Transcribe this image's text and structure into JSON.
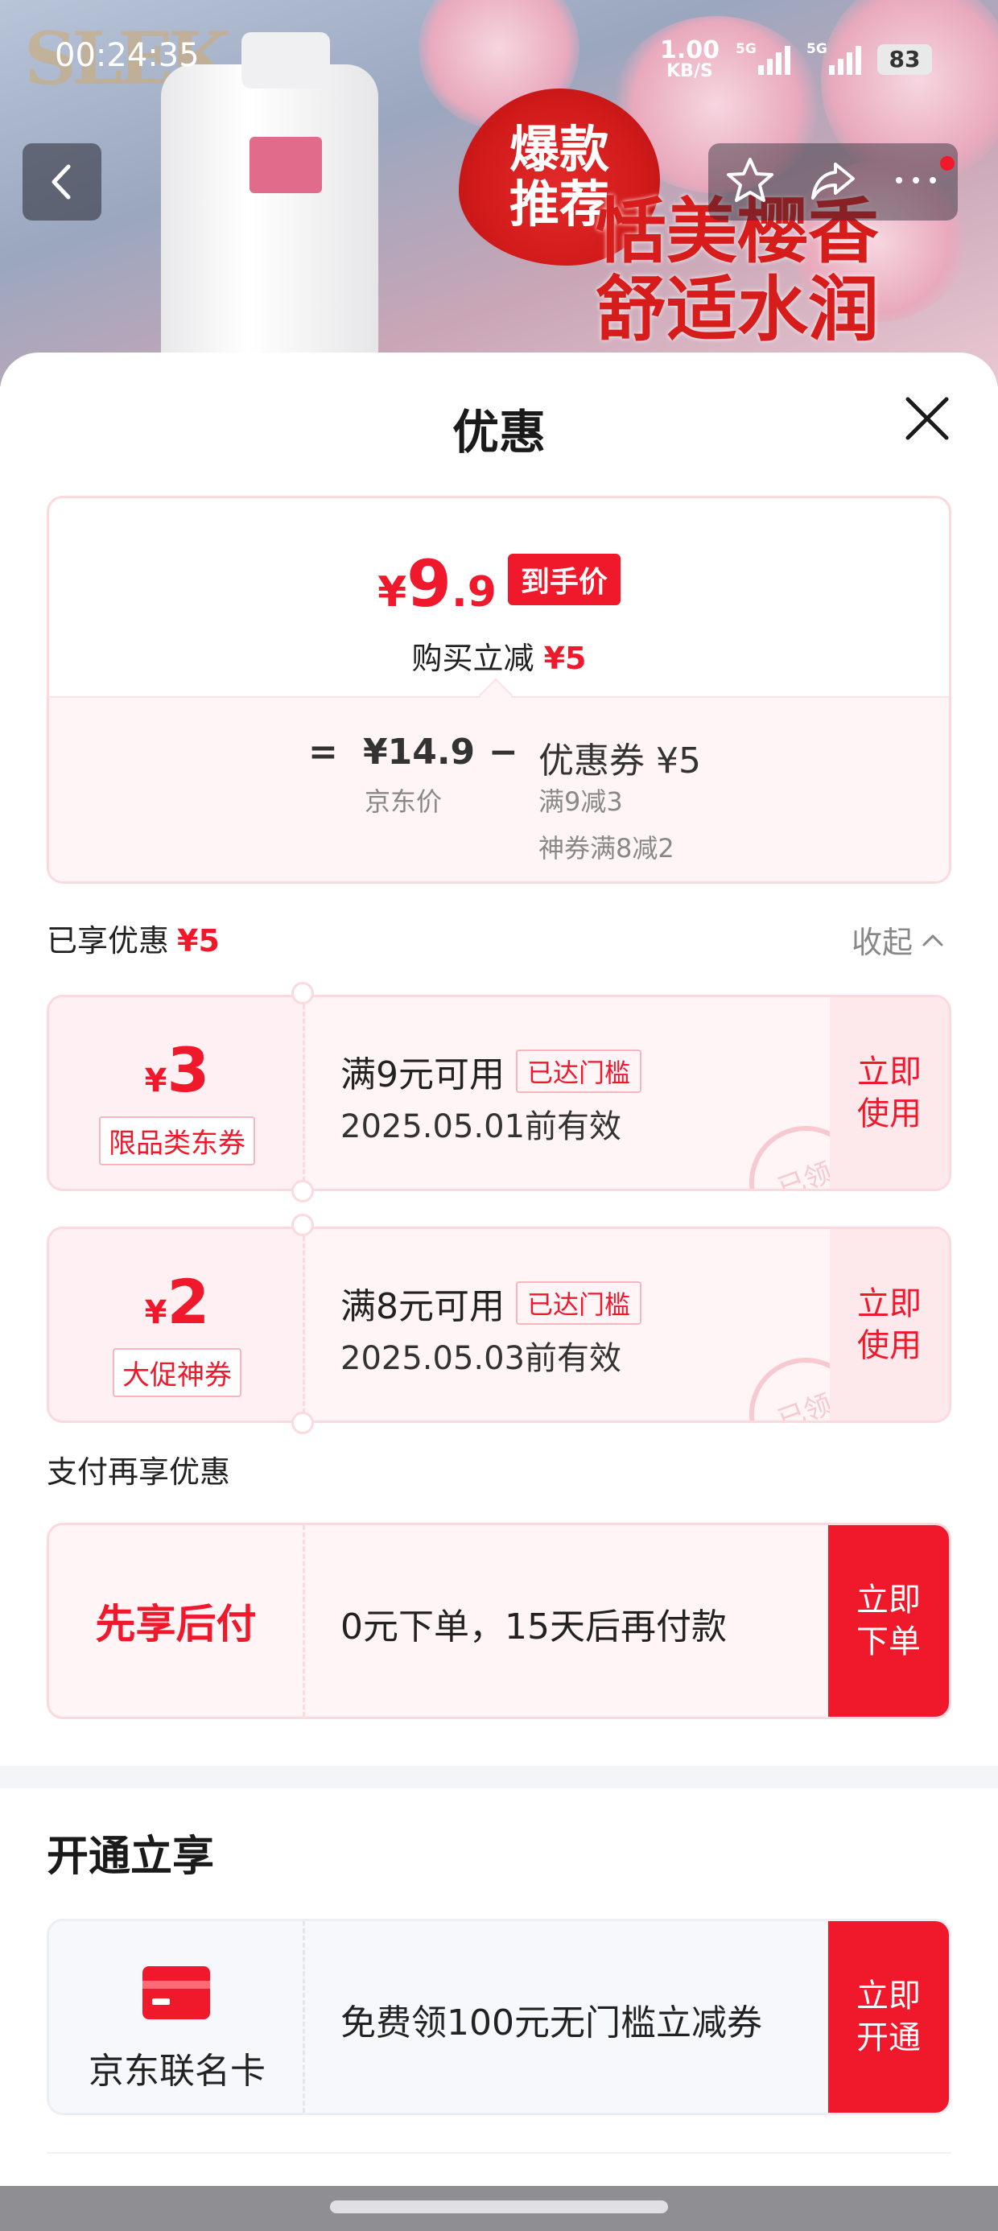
{
  "status_bar": {
    "time": "00:24:35",
    "net_speed_value": "1.00",
    "net_speed_unit": "KB/S",
    "signal1_tag": "5G",
    "signal2_tag": "5G",
    "battery": "83"
  },
  "banner": {
    "brand": "SLEK",
    "hot_badge_line1": "爆款",
    "hot_badge_line2": "推荐",
    "promo_line1": "恬美樱香",
    "promo_line2": "舒适水润"
  },
  "sheet": {
    "title": "优惠",
    "price": {
      "yen": "¥",
      "integer": "9",
      "decimal": ".9",
      "tag": "到手价",
      "reduce_label": "购买立减",
      "reduce_amount": "¥5"
    },
    "calc": {
      "equals": "=",
      "jd_price": "¥14.9",
      "jd_price_label": "京东价",
      "minus": "−",
      "coupon": "优惠券 ¥5",
      "coupon_rule1": "满9减3",
      "coupon_rule2": "神券满8减2"
    },
    "enjoyed": {
      "label": "已享优惠",
      "amount": "¥5",
      "collapse": "收起"
    },
    "coupons": [
      {
        "yen": "¥",
        "value": "3",
        "kind": "限品类东券",
        "condition": "满9元可用",
        "reached": "已达门槛",
        "expire": "2025.05.01前有效",
        "action": "立即\n使用",
        "stamp": "已领"
      },
      {
        "yen": "¥",
        "value": "2",
        "kind": "大促神券",
        "condition": "满8元可用",
        "reached": "已达门槛",
        "expire": "2025.05.03前有效",
        "action": "立即\n使用",
        "stamp": "已领"
      }
    ],
    "pay_section": {
      "label": "支付再享优惠",
      "name": "先享后付",
      "desc": "0元下单，15天后再付款",
      "action": "立即\n下单"
    },
    "open_section": {
      "title": "开通立享",
      "card_name": "京东联名卡",
      "desc": "免费领100元无门槛立减券",
      "action": "立即\n开通"
    }
  },
  "colors": {
    "accent": "#f0192c",
    "coupon_bg": "#fff5f6",
    "border": "#fbd9de"
  }
}
